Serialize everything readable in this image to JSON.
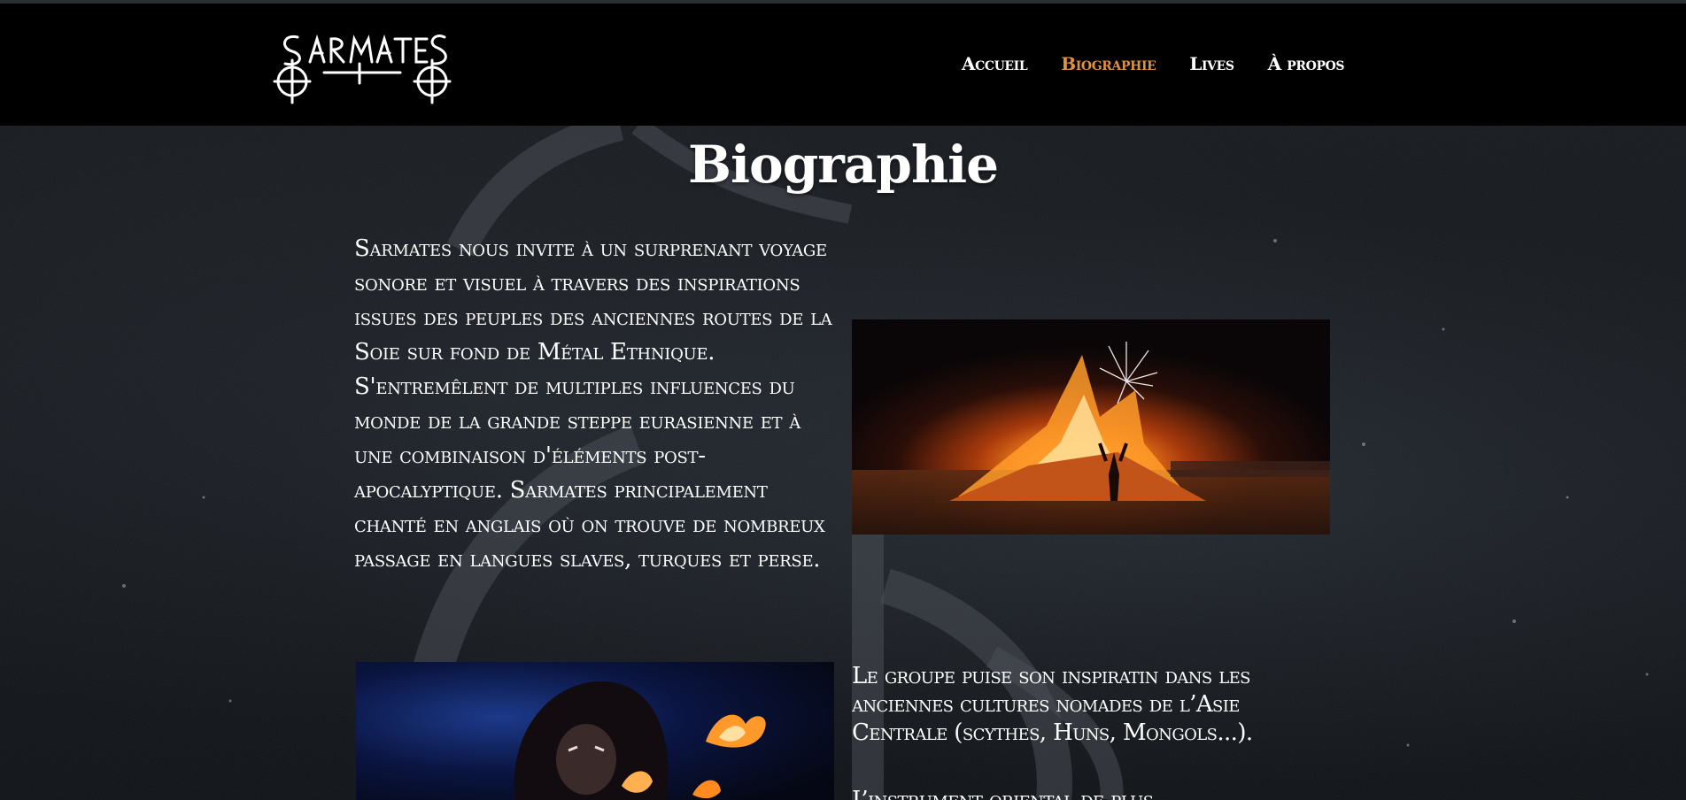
{
  "header": {
    "logo_text": "SARMATES",
    "nav": [
      {
        "label": "Accueil",
        "active": false
      },
      {
        "label": "Biographie",
        "active": true
      },
      {
        "label": "Lives",
        "active": false
      },
      {
        "label": "À propos",
        "active": false
      }
    ],
    "active_color": "#e0913f"
  },
  "main": {
    "title": "Biographie",
    "bio_paragraph": "Sarmates nous invite à un surprenant voyage sonore et visuel à travers des inspirations issues des peuples des anciennes routes de la Soie sur fond de Métal Ethnique. S'entremêlent de multiples influences du monde de la grande steppe eurasienne et à une combinaison d'éléments post-apocalyptique. Sarmates principalement chanté en anglais où on trouve de nombreux passage en langues slaves, turques et perse.",
    "paragraph_2": "Le groupe puise son inspiratin dans les anciennes cultures nomades de l’Asie Centrale (scythes, Huns, Mongols...).",
    "paragraph_3": "L’instrument oriental de plus"
  },
  "images": {
    "fire": "bonfire-night-photo",
    "performer": "fire-performer-photo"
  }
}
